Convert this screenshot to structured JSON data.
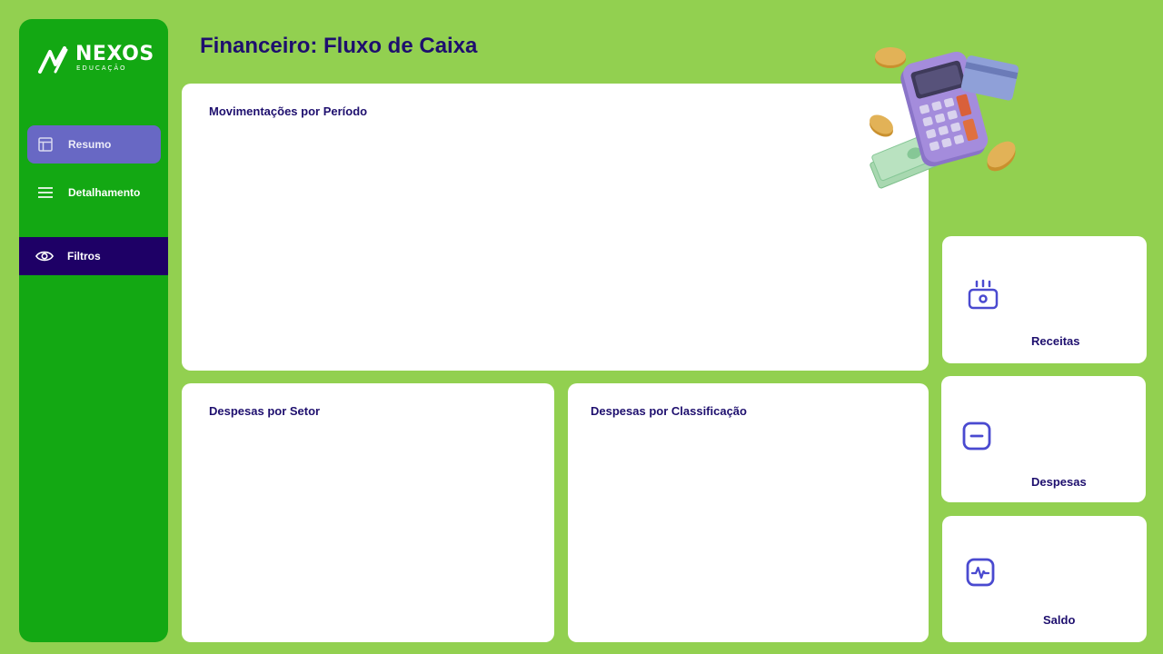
{
  "brand": {
    "name": "NEXOS",
    "tagline": "EDUCAÇÃO"
  },
  "sidebar": {
    "items": [
      {
        "label": "Resumo",
        "icon": "layout-icon",
        "active": true
      },
      {
        "label": "Detalhamento",
        "icon": "menu-lines-icon"
      },
      {
        "label": "Filtros",
        "icon": "eye-icon"
      }
    ]
  },
  "page": {
    "title": "Financeiro: Fluxo de Caixa"
  },
  "cards": {
    "movimentacoes": {
      "title": "Movimentações por Período"
    },
    "setor": {
      "title": "Despesas por Setor"
    },
    "classificacao": {
      "title": "Despesas por Classificação"
    }
  },
  "kpis": {
    "receitas": {
      "label": "Receitas",
      "icon": "money-icon"
    },
    "despesas": {
      "label": "Despesas",
      "icon": "minus-square-icon"
    },
    "saldo": {
      "label": "Saldo",
      "icon": "activity-icon"
    }
  },
  "colors": {
    "background": "#92d050",
    "sidebar": "#13a813",
    "active_nav": "#6868c4",
    "filter_nav": "#1e0066",
    "title": "#1e0f6e",
    "icon_accent": "#4a4ad0"
  }
}
